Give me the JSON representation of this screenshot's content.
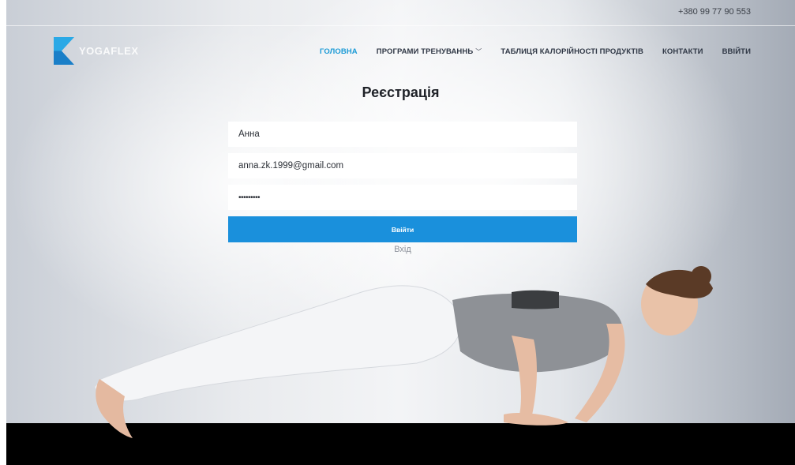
{
  "topbar": {
    "phone": "+380 99 77 90 553"
  },
  "brand": {
    "name": "YOGAFLEX",
    "accent": "#1a9ad6"
  },
  "nav": {
    "items": [
      {
        "label": "ГОЛОВНА",
        "active": true
      },
      {
        "label": "ПРОГРАМИ ТРЕНУВАННЬ",
        "dropdown": true
      },
      {
        "label": "ТАБЛИЦЯ КАЛОРІЙНОСТІ ПРОДУКТІВ"
      },
      {
        "label": "КОНТАКТИ"
      },
      {
        "label": "ВВІЙТИ"
      }
    ]
  },
  "form": {
    "title": "Реєстрація",
    "name_value": "Анна",
    "email_value": "anna.zk.1999@gmail.com",
    "password_value": "•••••••••",
    "submit_label": "Ввійти",
    "secondary_link": "Вхід",
    "button_color": "#1a90dc"
  }
}
